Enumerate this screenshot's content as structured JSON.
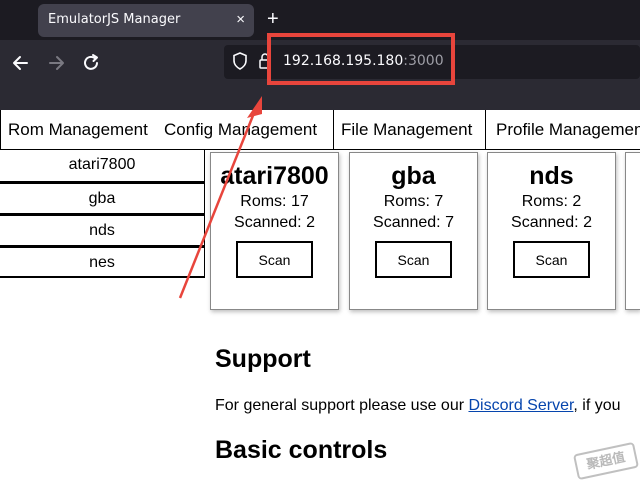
{
  "browser": {
    "tab_title": "EmulatorJS Manager",
    "tab_close": "×",
    "new_tab": "+",
    "url_host": "192.168.195.180",
    "url_port": ":3000"
  },
  "page_tabs": [
    {
      "label": "Rom Management"
    },
    {
      "label": "Config Management"
    },
    {
      "label": "File Management"
    },
    {
      "label": "Profile Management"
    }
  ],
  "platforms": [
    "atari7800",
    "gba",
    "nds",
    "nes"
  ],
  "cards": [
    {
      "title": "atari7800",
      "roms": "Roms: 17",
      "scanned": "Scanned: 2",
      "button": "Scan"
    },
    {
      "title": "gba",
      "roms": "Roms: 7",
      "scanned": "Scanned: 7",
      "button": "Scan"
    },
    {
      "title": "nds",
      "roms": "Roms: 2",
      "scanned": "Scanned: 2",
      "button": "Scan"
    }
  ],
  "support": {
    "heading": "Support",
    "text_before": "For general support please use our ",
    "link": "Discord Server",
    "text_after": ", if you"
  },
  "basic_controls": {
    "heading": "Basic controls"
  },
  "watermark": "聚超值",
  "colors": {
    "annotation_red": "#e8453c",
    "link_blue": "#0645ad",
    "chrome_dark": "#2b2a33"
  }
}
